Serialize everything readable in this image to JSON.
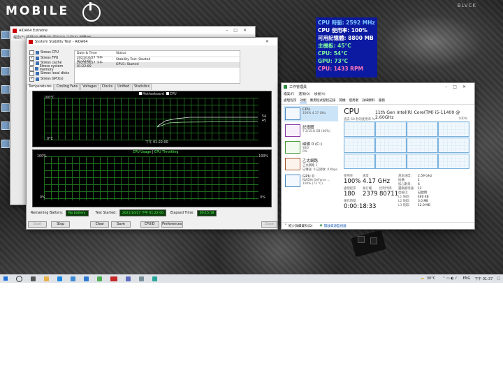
{
  "watermarks": {
    "logo": "MOBILE",
    "corner": "BLVCK"
  },
  "osd": {
    "lines": [
      {
        "text": "CPU 時脈: 2592 MHz",
        "color": "#7ec8ff"
      },
      {
        "text": "CPU 使用率: 100%",
        "color": "#ffffff"
      },
      {
        "text": "可用記憶體: 8800 MB",
        "color": "#ffffff"
      },
      {
        "text": "主機板: 45°C",
        "color": "#7cf0a0"
      },
      {
        "text": "CPU: 54°C",
        "color": "#7cf0a0"
      },
      {
        "text": "GPU: 73°C",
        "color": "#7cf0a0"
      },
      {
        "text": "CPU: 1433 RPM",
        "color": "#ff77bb"
      }
    ]
  },
  "aida_main": {
    "title": "AIDA64 Extreme",
    "menu": "檔案(F)  檢視(V)  報表(R)  喜好(O)  工具(T)  說明(H)"
  },
  "sst": {
    "title": "System Stability Test - AIDA64",
    "stress": [
      {
        "label": "Stress CPU",
        "checked": false
      },
      {
        "label": "Stress FPU",
        "checked": true
      },
      {
        "label": "Stress cache",
        "checked": false
      },
      {
        "label": "Stress system memory",
        "checked": false
      },
      {
        "label": "Stress local disks",
        "checked": false
      },
      {
        "label": "Stress GPU(s)",
        "checked": true
      }
    ],
    "table": {
      "headers": [
        "Date & Time",
        "Status"
      ],
      "rows": [
        [
          "2021/10/27 下午 01:22:00",
          "Stability Test: Started"
        ],
        [
          "2021/10/27 下午 01:22:00",
          "GPU1: Started"
        ]
      ]
    },
    "tabs": [
      "Temperatures",
      "Cooling Fans",
      "Voltages",
      "Clocks",
      "Unified",
      "Statistics"
    ],
    "temp_graph": {
      "legend": [
        "Motherboard",
        "CPU"
      ],
      "y_top": "100°C",
      "y_bottom": "0°C",
      "time": "下午 01:22:00",
      "right_values": [
        "54",
        "45"
      ]
    },
    "usage_graph": {
      "legend_a": "CPU Usage",
      "legend_b": "CPU Throttling",
      "y_top_left": "100%",
      "y_top_right": "100%",
      "y_bottom_left": "0%",
      "y_bottom_right": "0%"
    },
    "status": {
      "battery_label": "Remaining Battery:",
      "battery_value": "No battery",
      "started_label": "Test Started:",
      "started_value": "2021/10/27 下午 01:22:00",
      "elapsed_label": "Elapsed Time:",
      "elapsed_value": "00:15:18"
    },
    "buttons": [
      "Start",
      "Stop",
      "Clear",
      "Save",
      "CPUID",
      "Preferences",
      "Close"
    ]
  },
  "taskmgr": {
    "title": "工作管理員",
    "menu": [
      "檔案(F)",
      "選項(O)",
      "檢視(V)"
    ],
    "tabs": [
      "處理程序",
      "效能",
      "應用程式歷程記錄",
      "開機",
      "使用者",
      "詳細資料",
      "服務"
    ],
    "side": [
      {
        "name": "CPU",
        "sub": "100% 4.17 GHz"
      },
      {
        "name": "記憶體",
        "sub": "7.2/15.8 GB (46%)"
      },
      {
        "name": "磁碟 0 (C:)",
        "sub": "SSD",
        "sub2": "0%"
      },
      {
        "name": "乙太網路",
        "sub": "乙太網路 3",
        "sub2": "已傳送: 0 已接收: 0 Kbps"
      },
      {
        "name": "GPU 0",
        "sub": "NVIDIA GeForce ...",
        "sub2": "100% (73 °C)"
      }
    ],
    "heading": "CPU",
    "model": "11th Gen Intel(R) Core(TM) i5-11400 @ 2.60GHz",
    "graph_label": "過去 60 秒的使用率 %",
    "graph_max": "100%",
    "usage_label": "使用率",
    "usage_value": "100%",
    "speed_label": "速度",
    "speed_value": "4.17 GHz",
    "proc_label": "處理程序",
    "proc_value": "180",
    "threads_label": "執行緒",
    "threads_value": "2379",
    "handles_label": "控制代碼",
    "handles_value": "80711",
    "uptime_label": "運作時間",
    "uptime_value": "0:00:18:33",
    "details": [
      [
        "基本速度:",
        "2.59 GHz"
      ],
      [
        "插槽:",
        "1"
      ],
      [
        "核心數目:",
        "6"
      ],
      [
        "邏輯處理器:",
        "12"
      ],
      [
        "虛擬化:",
        "已啟用"
      ],
      [
        "L1 快取:",
        "480 KB"
      ],
      [
        "L2 快取:",
        "3.0 MB"
      ],
      [
        "L3 快取:",
        "12.0 MB"
      ]
    ],
    "footer_less": "較少詳細資料(D)",
    "footer_monitor": "開啟資源監視器"
  },
  "taskbar": {
    "weather": "30°C",
    "lang": "ENG",
    "time": "下午 01:37"
  }
}
